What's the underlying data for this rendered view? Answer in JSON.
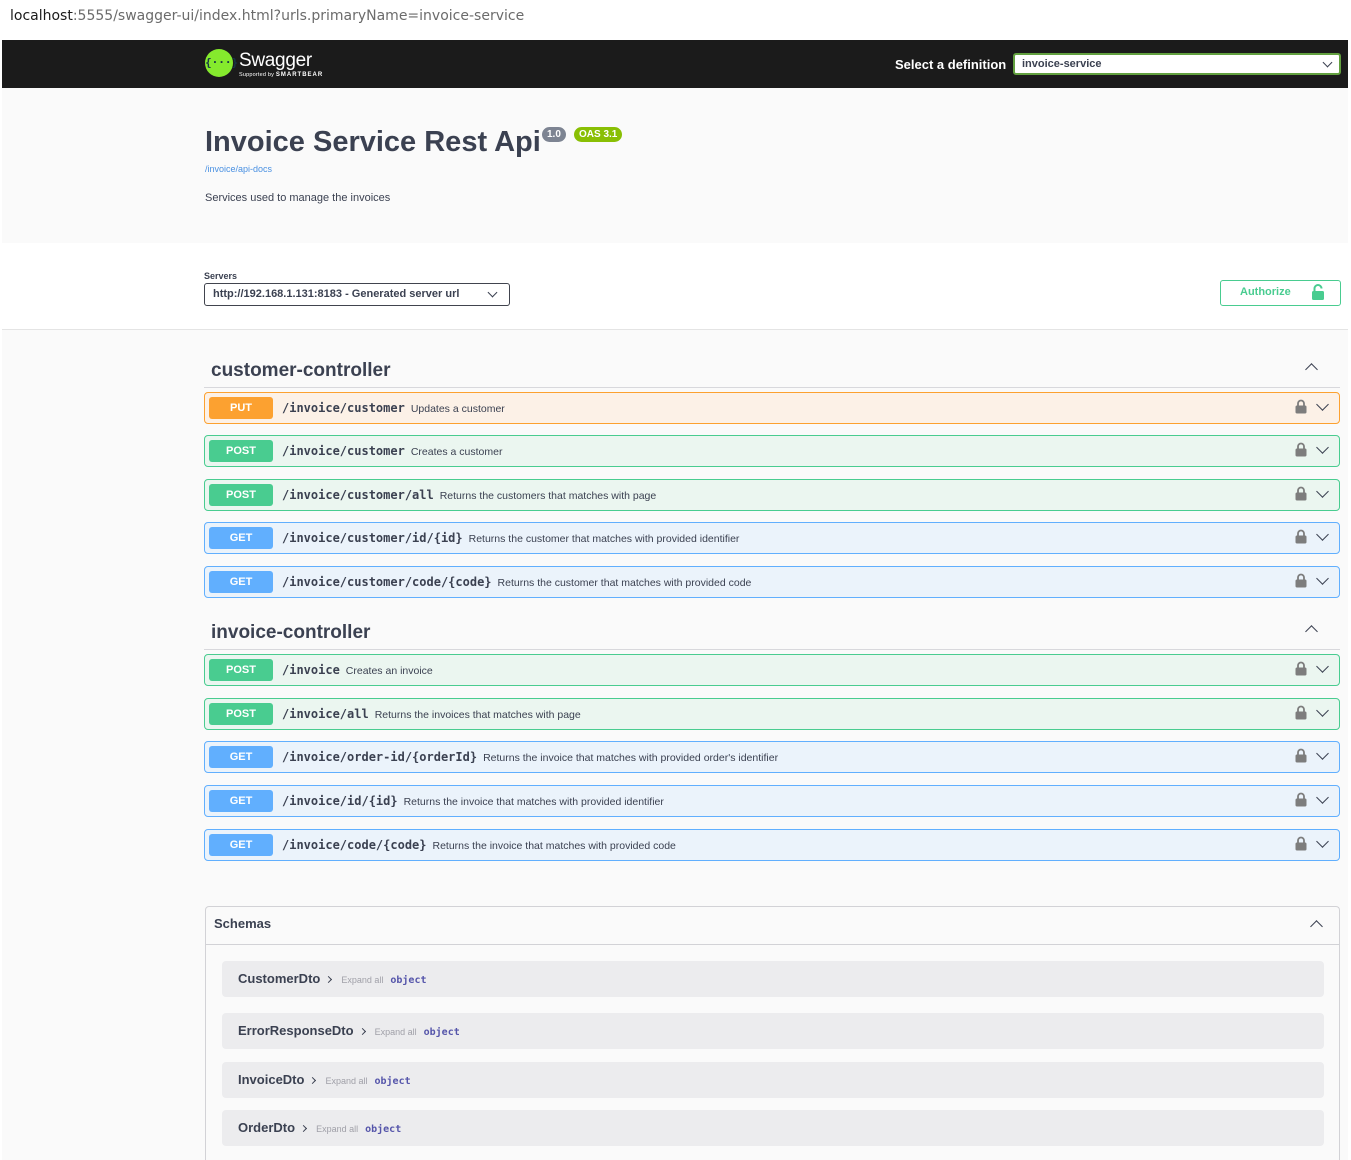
{
  "browser": {
    "url_host": "localhost",
    "url_rest": ":5555/swagger-ui/index.html?urls.primaryName=invoice-service"
  },
  "topbar": {
    "logo_icon": "swagger-logo-icon",
    "logo_text": "Swagger",
    "logo_sub_prefix": "Supported by",
    "logo_sub_brand": "SMARTBEAR",
    "definition_label": "Select a definition",
    "definition_value": "invoice-service"
  },
  "info": {
    "title": "Invoice Service Rest Api",
    "version": "1.0",
    "oas": "OAS 3.1",
    "api_docs_link": "/invoice/api-docs",
    "description": "Services used to manage the invoices"
  },
  "servers": {
    "label": "Servers",
    "selected": "http://192.168.1.131:8183 - Generated server url"
  },
  "authorize": {
    "label": "Authorize"
  },
  "tags": [
    {
      "name": "customer-controller",
      "operations": [
        {
          "method": "PUT",
          "path": "/invoice/customer",
          "summary": "Updates a customer"
        },
        {
          "method": "POST",
          "path": "/invoice/customer",
          "summary": "Creates a customer"
        },
        {
          "method": "POST",
          "path": "/invoice/customer/all",
          "summary": "Returns the customers that matches with page"
        },
        {
          "method": "GET",
          "path": "/invoice/customer/id/{id}",
          "summary": "Returns the customer that matches with provided identifier"
        },
        {
          "method": "GET",
          "path": "/invoice/customer/code/{code}",
          "summary": "Returns the customer that matches with provided code"
        }
      ]
    },
    {
      "name": "invoice-controller",
      "operations": [
        {
          "method": "POST",
          "path": "/invoice",
          "summary": "Creates an invoice"
        },
        {
          "method": "POST",
          "path": "/invoice/all",
          "summary": "Returns the invoices that matches with page"
        },
        {
          "method": "GET",
          "path": "/invoice/order-id/{orderId}",
          "summary": "Returns the invoice that matches with provided order's identifier"
        },
        {
          "method": "GET",
          "path": "/invoice/id/{id}",
          "summary": "Returns the invoice that matches with provided identifier"
        },
        {
          "method": "GET",
          "path": "/invoice/code/{code}",
          "summary": "Returns the invoice that matches with provided code"
        }
      ]
    }
  ],
  "schemas": {
    "title": "Schemas",
    "expand_all_label": "Expand all",
    "models": [
      {
        "name": "CustomerDto",
        "type": "object"
      },
      {
        "name": "ErrorResponseDto",
        "type": "object"
      },
      {
        "name": "InvoiceDto",
        "type": "object"
      },
      {
        "name": "OrderDto",
        "type": "object"
      }
    ]
  },
  "colors": {
    "put": "#fca130",
    "post": "#49cc90",
    "get": "#61affe",
    "topbar": "#1b1b1b",
    "logo": "#85ea2d"
  }
}
